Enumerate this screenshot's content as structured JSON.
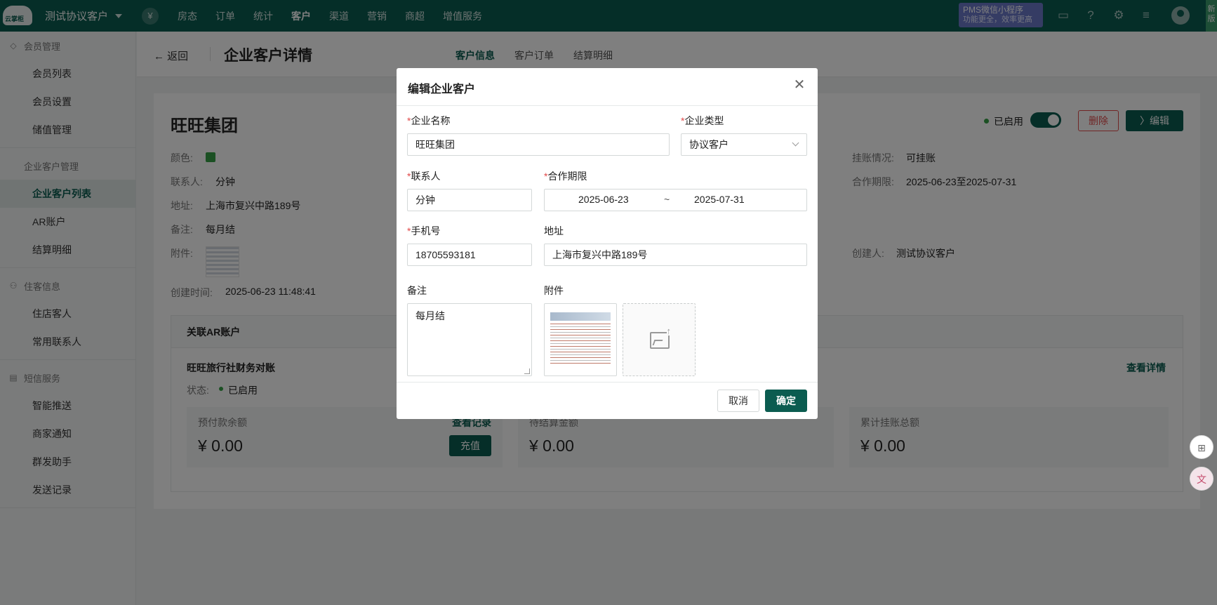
{
  "topnav": {
    "logo_text": "云掌柜",
    "hotel_name": "测试协议客户",
    "yen_symbol": "¥",
    "items": [
      "房态",
      "订单",
      "统计",
      "客户",
      "渠道",
      "营销",
      "商超",
      "增值服务"
    ],
    "active_index": 3,
    "promo_line1": "PMS微信小程序",
    "promo_line2": "功能更全，效率更高",
    "new_version": "新版"
  },
  "sidebar": {
    "groups": [
      {
        "label": "会员管理",
        "icon": "diamond-icon",
        "items": [
          "会员列表",
          "会员设置",
          "储值管理"
        ]
      },
      {
        "label": "企业客户管理",
        "icon": "",
        "items": [
          "企业客户列表",
          "AR账户",
          "结算明细"
        ]
      },
      {
        "label": "住客信息",
        "icon": "people-icon",
        "items": [
          "住店客人",
          "常用联系人"
        ]
      },
      {
        "label": "短信服务",
        "icon": "message-icon",
        "items": [
          "智能推送",
          "商家通知",
          "群发助手",
          "发送记录"
        ]
      }
    ],
    "active_item": "企业客户列表"
  },
  "header": {
    "back_label": "返回",
    "title": "企业客户详情",
    "tabs": [
      "客户信息",
      "客户订单",
      "结算明细"
    ]
  },
  "detail": {
    "name": "旺旺集团",
    "color_label": "颜色:",
    "contact_label": "联系人:",
    "contact_value": "分钟",
    "address_label": "地址:",
    "address_value": "上海市复兴中路189号",
    "remark_label": "备注:",
    "remark_value": "每月结",
    "attachment_label": "附件:",
    "created_time_label": "创建时间:",
    "created_time_value": "2025-06-23 11:48:41",
    "credit_label": "挂账情况:",
    "credit_value": "可挂账",
    "period_label": "合作期限:",
    "period_value": "2025-06-23至2025-07-31",
    "creator_label": "创建人:",
    "creator_value": "测试协议客户",
    "status_text": "已启用",
    "delete_label": "删除",
    "edit_label": "〉编辑",
    "swatch_color": "#37a046"
  },
  "ar": {
    "section_title": "关联AR账户",
    "account_name": "旺旺旅行社财务对账",
    "detail_link": "查看详情",
    "status_label": "状态:",
    "status_value": "已启用",
    "cards": [
      {
        "label": "预付款余额",
        "value": "¥ 0.00",
        "link": "查看记录",
        "button": "充值"
      },
      {
        "label": "待结算金额",
        "value": "¥ 0.00"
      },
      {
        "label": "累计挂账总额",
        "value": "¥ 0.00"
      }
    ]
  },
  "modal": {
    "title": "编辑企业客户",
    "close_symbol": "✕",
    "company_name_label": "企业名称",
    "company_name_value": "旺旺集团",
    "company_type_label": "企业类型",
    "company_type_value": "协议客户",
    "contact_label": "联系人",
    "contact_value": "分钟",
    "period_label": "合作期限",
    "period_start": "2025-06-23",
    "period_sep": "~",
    "period_end": "2025-07-31",
    "phone_label": "手机号",
    "phone_value": "18705593181",
    "address_label": "地址",
    "address_value": "上海市复兴中路189号",
    "remark_label": "备注",
    "remark_value": "每月结",
    "attachment_label": "附件",
    "required_mark": "*",
    "cancel_label": "取消",
    "confirm_label": "确定"
  },
  "colors": {
    "brand": "#0b5c50",
    "danger": "#e14a4a",
    "success": "#37a046"
  }
}
